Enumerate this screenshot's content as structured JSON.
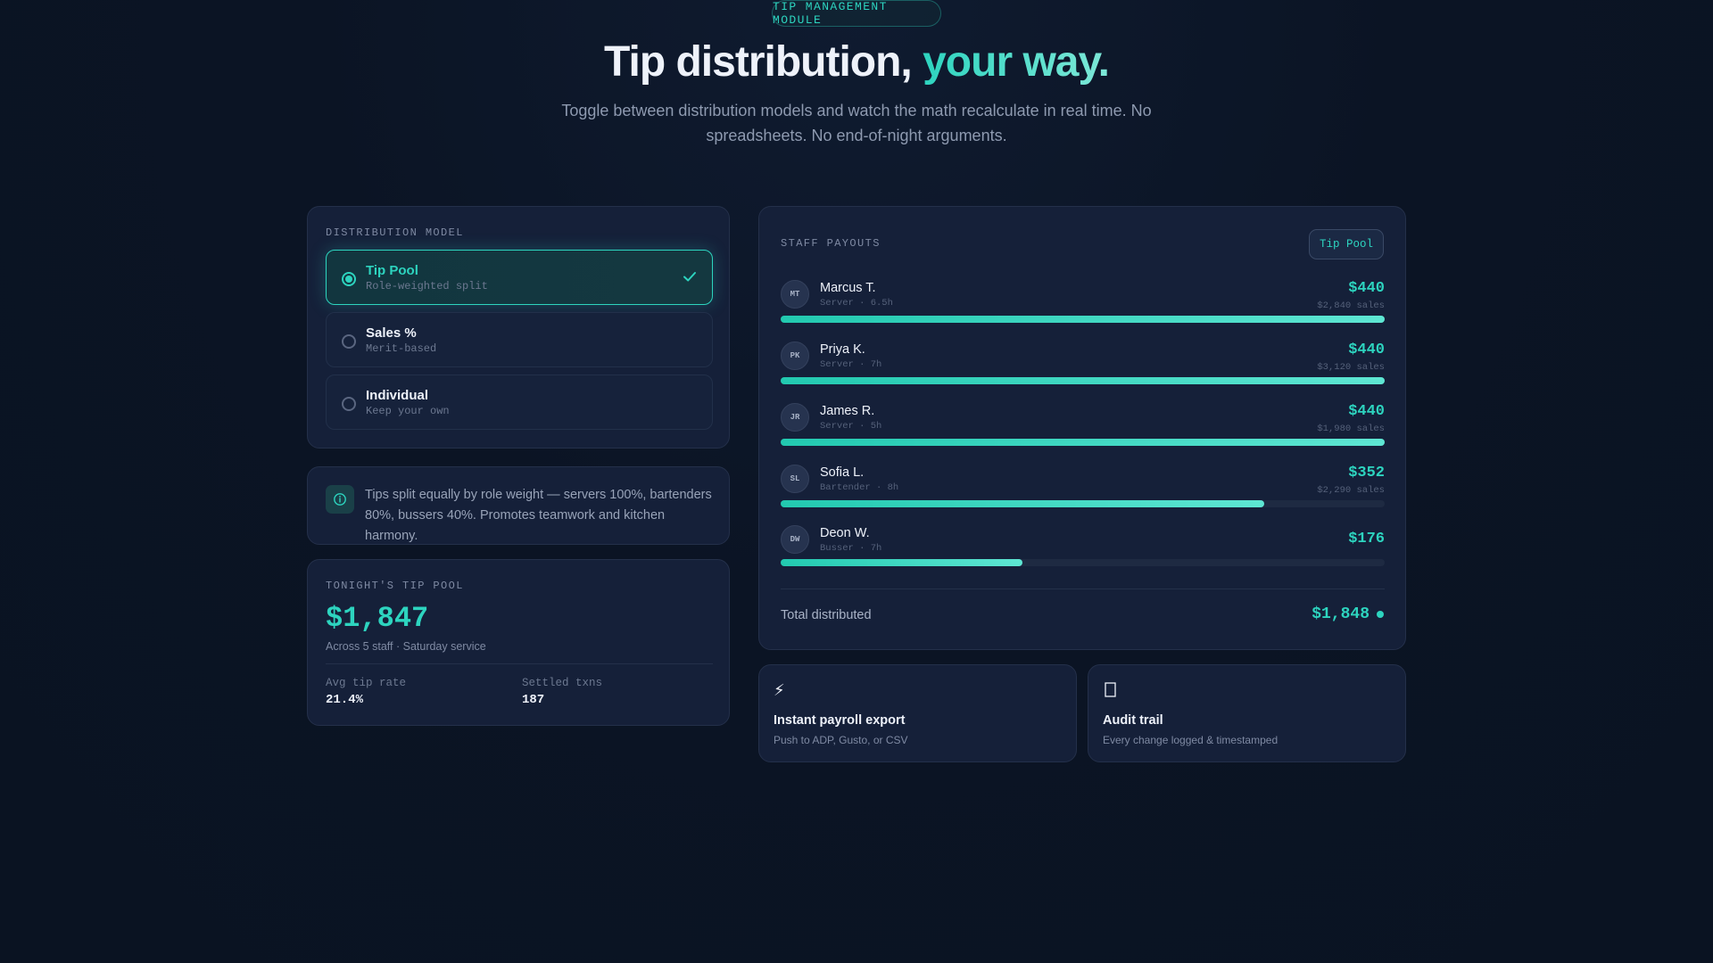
{
  "hero": {
    "badge": "TIP MANAGEMENT MODULE",
    "title_main": "Tip distribution, ",
    "title_accent": "your way.",
    "subtitle": "Toggle between distribution models and watch the math recalculate in real time. No spreadsheets. No end-of-night arguments."
  },
  "model": {
    "label": "DISTRIBUTION MODEL",
    "options": [
      {
        "title": "Tip Pool",
        "subtitle": "Role-weighted split",
        "selected": true
      },
      {
        "title": "Sales %",
        "subtitle": "Merit-based",
        "selected": false
      },
      {
        "title": "Individual",
        "subtitle": "Keep your own",
        "selected": false
      }
    ]
  },
  "info": {
    "icon": "info-icon",
    "text": "Tips split equally by role weight — servers 100%, bartenders 80%, bussers 40%. Promotes teamwork and kitchen harmony."
  },
  "pool": {
    "label": "TONIGHT'S TIP POOL",
    "amount": "$1,847",
    "subtitle": "Across 5 staff · Saturday service",
    "stats": [
      {
        "label": "Avg tip rate",
        "value": "21.4%"
      },
      {
        "label": "Settled txns",
        "value": "187"
      }
    ]
  },
  "staff": {
    "label": "STAFF PAYOUTS",
    "model_tag": "Tip Pool",
    "rows": [
      {
        "initials": "MT",
        "name": "Marcus T.",
        "meta": "Server · 6.5h",
        "amount": "$440",
        "sales": "$2,840 sales",
        "share": 1.0
      },
      {
        "initials": "PK",
        "name": "Priya K.",
        "meta": "Server · 7h",
        "amount": "$440",
        "sales": "$3,120 sales",
        "share": 1.0
      },
      {
        "initials": "JR",
        "name": "James R.",
        "meta": "Server · 5h",
        "amount": "$440",
        "sales": "$1,980 sales",
        "share": 1.0
      },
      {
        "initials": "SL",
        "name": "Sofia L.",
        "meta": "Bartender · 8h",
        "amount": "$352",
        "sales": "$2,290 sales",
        "share": 0.8
      },
      {
        "initials": "DW",
        "name": "Deon W.",
        "meta": "Busser · 7h",
        "amount": "$176",
        "sales": "",
        "share": 0.4
      }
    ],
    "total_label": "Total distributed",
    "total_value": "$1,848"
  },
  "features": [
    {
      "icon": "lightning-icon",
      "title": "Instant payroll export",
      "subtitle": "Push to ADP, Gusto, or CSV"
    },
    {
      "icon": "audit-icon",
      "title": "Audit trail",
      "subtitle": "Every change logged & timestamped"
    }
  ],
  "colors": {
    "accent": "#2dd4bf",
    "background": "#0b1424",
    "card": "#152039"
  }
}
